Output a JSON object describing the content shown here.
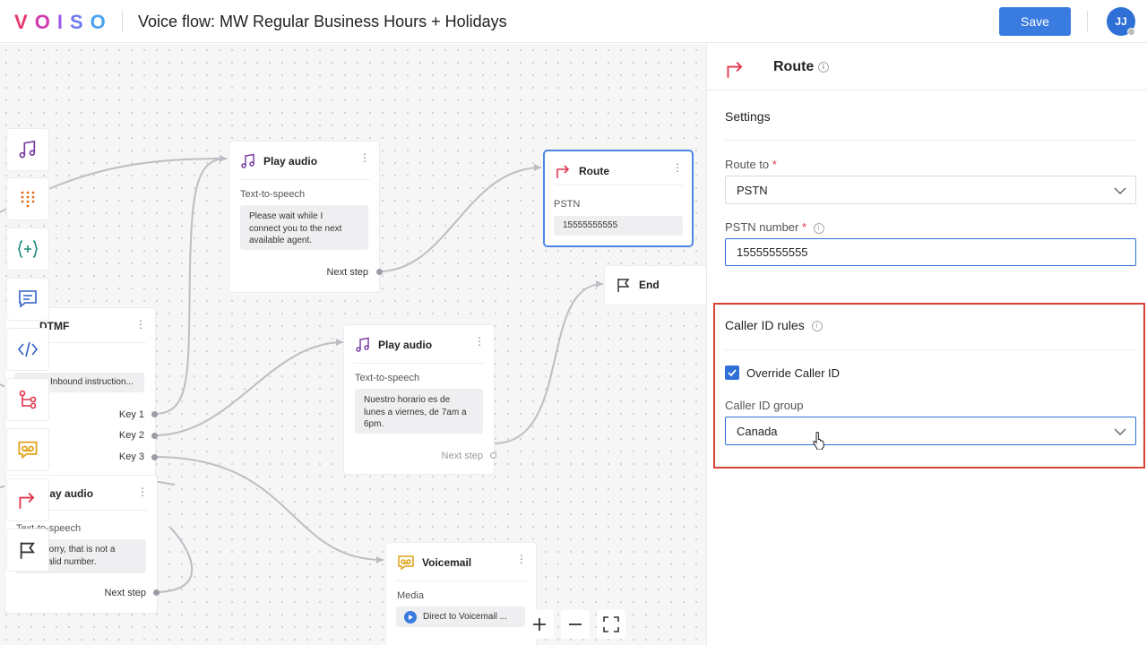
{
  "header": {
    "logo_letters": [
      "V",
      "O",
      "I",
      "S",
      "O"
    ],
    "logo_colors": [
      "#e8356c",
      "#d13bb0",
      "#9b5de5",
      "#6f7cf0",
      "#4aa3f0"
    ],
    "title": "Voice flow: MW Regular Business Hours + Holidays",
    "save_label": "Save",
    "avatar_initials": "JJ"
  },
  "toolbar": {
    "icons": [
      "music-note-icon",
      "dialpad-icon",
      "variable-icon",
      "message-icon",
      "code-icon",
      "branch-icon",
      "voicemail-icon",
      "route-icon",
      "flag-icon"
    ]
  },
  "canvas": {
    "nodes": {
      "play_audio_1": {
        "title": "Play audio",
        "label": "Text-to-speech",
        "text_lines": [
          "Please wait while I",
          "connect you to the next",
          "available agent."
        ],
        "next_step": "Next step"
      },
      "route": {
        "title": "Route",
        "label": "PSTN",
        "value": "15555555555"
      },
      "end": {
        "title": "End"
      },
      "dtmf": {
        "title": "DTMF",
        "value": "Inbound instruction...",
        "keys": [
          "Key 1",
          "Key 2",
          "Key 3"
        ]
      },
      "play_audio_2": {
        "title": "Play audio",
        "label": "Text-to-speech",
        "text_lines": [
          "Nuestro horario es de",
          "lunes a viernes, de 7am a",
          "6pm."
        ],
        "next_step": "Next step"
      },
      "play_audio_3": {
        "title": "Play audio",
        "label": "Text-to-speech",
        "text_lines": [
          "Sorry, that is not a",
          "valid number."
        ],
        "next_step": "Next step"
      },
      "voicemail": {
        "title": "Voicemail",
        "label": "Media",
        "value": "Direct to Voicemail ..."
      }
    },
    "zoom": {
      "in": "+",
      "out": "−"
    }
  },
  "panel": {
    "title": "Route",
    "settings_title": "Settings",
    "route_to": {
      "label": "Route to",
      "value": "PSTN"
    },
    "pstn_number": {
      "label": "PSTN number",
      "value": "15555555555"
    },
    "caller_id_rules": {
      "title": "Caller ID rules",
      "override_label": "Override Caller ID",
      "override_checked": true,
      "group_label": "Caller ID group",
      "group_value": "Canada"
    },
    "required_mark": "*"
  },
  "colors": {
    "accent": "#2f6fd6",
    "save": "#3a7be0",
    "highlight": "#d94335",
    "route_red": "#e0344d",
    "music_purple": "#7a3fa0",
    "dialpad_orange": "#e06a1a",
    "variable_teal": "#1a8c7a",
    "message_blue": "#2f5fc4",
    "voicemail_yellow": "#e0a21a"
  }
}
